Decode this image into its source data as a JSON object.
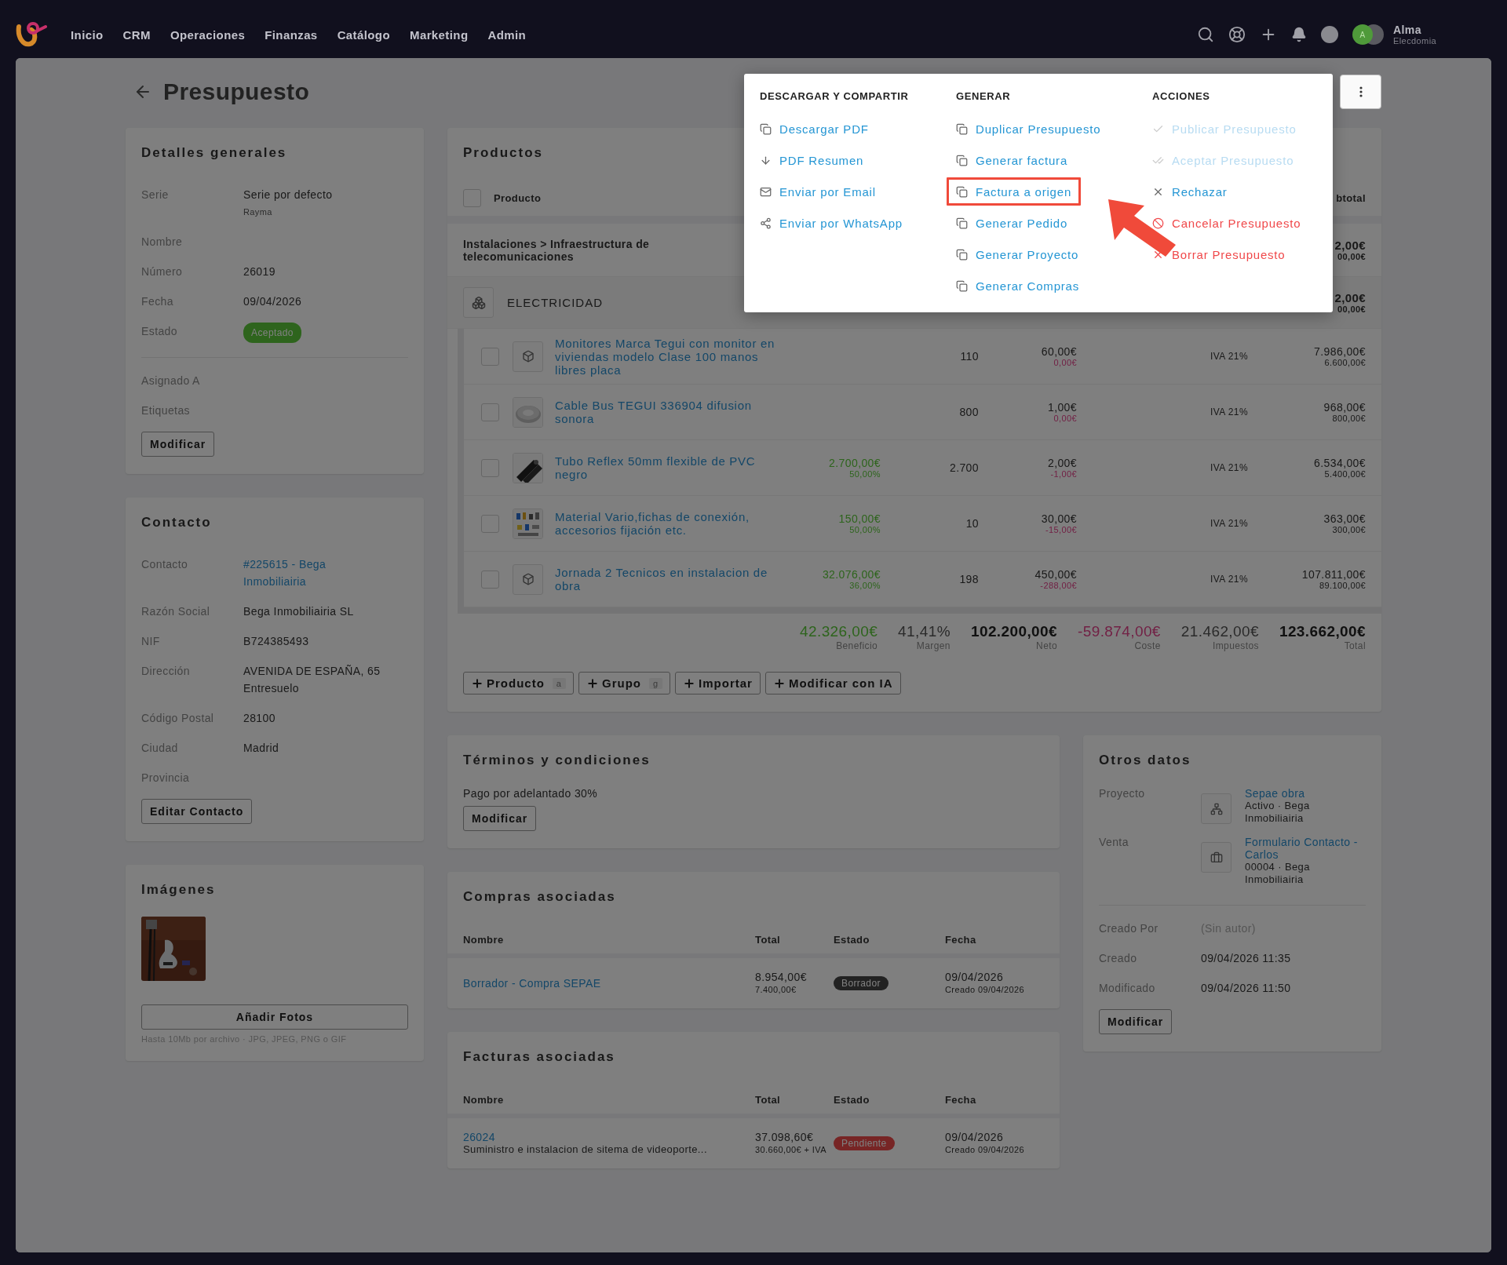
{
  "nav": {
    "items": [
      "Inicio",
      "CRM",
      "Operaciones",
      "Finanzas",
      "Catálogo",
      "Marketing",
      "Admin"
    ],
    "user": {
      "initial": "A",
      "name": "Alma",
      "company": "Elecdomia"
    }
  },
  "header": {
    "title": "Presupuesto"
  },
  "menu": {
    "columns": [
      {
        "heading": "DESCARGAR Y COMPARTIR",
        "items": [
          {
            "label": "Descargar PDF",
            "kind": "link",
            "highlighted": false
          },
          {
            "label": "PDF Resumen",
            "kind": "link",
            "highlighted": false
          },
          {
            "label": "Enviar por Email",
            "kind": "link",
            "highlighted": false
          },
          {
            "label": "Enviar por WhatsApp",
            "kind": "link",
            "highlighted": false
          }
        ]
      },
      {
        "heading": "GENERAR",
        "items": [
          {
            "label": "Duplicar Presupuesto",
            "kind": "link",
            "highlighted": false
          },
          {
            "label": "Generar factura",
            "kind": "link",
            "highlighted": false
          },
          {
            "label": "Factura a origen",
            "kind": "link",
            "highlighted": true
          },
          {
            "label": "Generar Pedido",
            "kind": "link",
            "highlighted": false
          },
          {
            "label": "Generar Proyecto",
            "kind": "link",
            "highlighted": false
          },
          {
            "label": "Generar Compras",
            "kind": "link",
            "highlighted": false
          }
        ]
      },
      {
        "heading": "ACCIONES",
        "items": [
          {
            "label": "Publicar Presupuesto",
            "kind": "disabled",
            "highlighted": false
          },
          {
            "label": "Aceptar Presupuesto",
            "kind": "disabled",
            "highlighted": false
          },
          {
            "label": "Rechazar",
            "kind": "link",
            "highlighted": false
          },
          {
            "label": "Cancelar Presupuesto",
            "kind": "danger",
            "highlighted": false
          },
          {
            "label": "Borrar Presupuesto",
            "kind": "danger",
            "highlighted": false
          }
        ]
      }
    ]
  },
  "details": {
    "title": "Detalles generales",
    "rows": [
      {
        "label": "Serie",
        "value": "Serie por defecto",
        "note": "Rayma"
      },
      {
        "label": "Nombre"
      },
      {
        "label": "Número",
        "value": "26019"
      },
      {
        "label": "Fecha",
        "value": "09/04/2026"
      },
      {
        "label": "Estado",
        "badge": "Aceptado"
      }
    ],
    "extra_rows": [
      {
        "label": "Asignado A"
      },
      {
        "label": "Etiquetas"
      }
    ],
    "button": "Modificar"
  },
  "contact": {
    "title": "Contacto",
    "rows": [
      {
        "label": "Contacto",
        "value": "#225615 - Bega Inmobiliairia",
        "kind": "link"
      },
      {
        "label": "Razón Social",
        "value": "Bega Inmobiliairia SL",
        "kind": "text"
      },
      {
        "label": "NIF",
        "value": "B724385493",
        "kind": "text"
      },
      {
        "label": "Dirección",
        "value": "AVENIDA DE ESPAÑA, 65 Entresuelo",
        "kind": "text"
      },
      {
        "label": "Código Postal",
        "value": "28100",
        "kind": "text"
      },
      {
        "label": "Ciudad",
        "value": "Madrid",
        "kind": "text"
      },
      {
        "label": "Provincia"
      }
    ],
    "button": "Editar Contacto"
  },
  "images": {
    "title": "Imágenes",
    "button": "Añadir Fotos",
    "hint": "Hasta 10Mb por archivo · JPG, JPEG, PNG o GIF"
  },
  "products": {
    "title": "Productos",
    "header": {
      "product": "Producto",
      "subtotal": "btotal",
      "checked": false
    },
    "group": {
      "name": "Instalaciones > Infraestructura de telecomunicaciones",
      "total": "2,00€",
      "base": "00,00€"
    },
    "subgroup": {
      "name": "ELECTRICIDAD",
      "total": "2,00€",
      "base": "00,00€"
    },
    "rows": [
      {
        "name": "Monitores Marca Tegui con monitor en viviendas modelo Clase 100 manos libres placa",
        "kind": "icon",
        "qty": "110",
        "price": "60,00€",
        "discount": "0,00€",
        "tax": "IVA 21%",
        "subtotal": "7.986,00€",
        "base": "6.600,00€",
        "checked": false
      },
      {
        "name": "Cable Bus TEGUI 336904 difusion sonora",
        "kind": "picture",
        "qty": "800",
        "price": "1,00€",
        "discount": "0,00€",
        "tax": "IVA 21%",
        "subtotal": "968,00€",
        "base": "800,00€",
        "checked": false
      },
      {
        "name": "Tubo Reflex 50mm flexible de PVC negro",
        "kind": "picture",
        "profit": "2.700,00€",
        "profit_pct": "50,00%",
        "qty": "2.700",
        "price": "2,00€",
        "discount": "-1,00€",
        "tax": "IVA 21%",
        "subtotal": "6.534,00€",
        "base": "5.400,00€",
        "checked": false
      },
      {
        "name": "Material Vario,fichas de conexión, accesorios fijación etc.",
        "kind": "picture",
        "profit": "150,00€",
        "profit_pct": "50,00%",
        "qty": "10",
        "price": "30,00€",
        "discount": "-15,00€",
        "tax": "IVA 21%",
        "subtotal": "363,00€",
        "base": "300,00€",
        "checked": false
      },
      {
        "name": "Jornada 2 Tecnicos en instalacion de obra",
        "kind": "icon",
        "profit": "32.076,00€",
        "profit_pct": "36,00%",
        "qty": "198",
        "price": "450,00€",
        "discount": "-288,00€",
        "tax": "IVA 21%",
        "subtotal": "107.811,00€",
        "base": "89.100,00€",
        "checked": false
      }
    ],
    "totals": [
      {
        "value": "42.326,00€",
        "label": "Beneficio",
        "kind": "positive"
      },
      {
        "value": "41,41%",
        "label": "Margen",
        "kind": "plain"
      },
      {
        "value": "102.200,00€",
        "label": "Neto",
        "kind": "strong"
      },
      {
        "value": "-59.874,00€",
        "label": "Coste",
        "kind": "negative"
      },
      {
        "value": "21.462,00€",
        "label": "Impuestos",
        "kind": "plain"
      },
      {
        "value": "123.662,00€",
        "label": "Total",
        "kind": "strong"
      }
    ],
    "actions": [
      {
        "label": "Producto",
        "key": "a"
      },
      {
        "label": "Grupo",
        "key": "g"
      },
      {
        "label": "Importar"
      },
      {
        "label": "Modificar con IA"
      }
    ]
  },
  "terms": {
    "title": "Términos y condiciones",
    "text": "Pago por adelantado 30%",
    "button": "Modificar"
  },
  "purchases": {
    "title": "Compras asociadas",
    "columns": [
      "Nombre",
      "Total",
      "Estado",
      "Fecha"
    ],
    "rows": [
      {
        "name": "Borrador - Compra SEPAE",
        "total": "8.954,00€",
        "total_sub": "7.400,00€",
        "status": {
          "label": "Borrador",
          "kind": "draft"
        },
        "date": "09/04/2026",
        "date_sub": "Creado 09/04/2026"
      }
    ]
  },
  "invoices": {
    "title": "Facturas asociadas",
    "columns": [
      "Nombre",
      "Total",
      "Estado",
      "Fecha"
    ],
    "rows": [
      {
        "name": "26024",
        "description": "Suministro e instalacion de sitema de videoporte...",
        "total": "37.098,60€",
        "total_sub": "30.660,00€ + IVA",
        "status": {
          "label": "Pendiente",
          "kind": "pending"
        },
        "date": "09/04/2026",
        "date_sub": "Creado 09/04/2026"
      }
    ]
  },
  "other": {
    "title": "Otros datos",
    "links": [
      {
        "label": "Proyecto",
        "title": "Sepae obra",
        "sub": "Activo · Bega Inmobiliairia"
      },
      {
        "label": "Venta",
        "title": "Formulario Contacto - Carlos",
        "sub": "00004 · Bega Inmobiliairia"
      }
    ],
    "meta": [
      {
        "label": "Creado Por",
        "value": "(Sin autor)",
        "kind": "muted"
      },
      {
        "label": "Creado",
        "value": "09/04/2026 11:35",
        "kind": "text"
      },
      {
        "label": "Modificado",
        "value": "09/04/2026 11:50",
        "kind": "text"
      }
    ],
    "button": "Modificar"
  }
}
